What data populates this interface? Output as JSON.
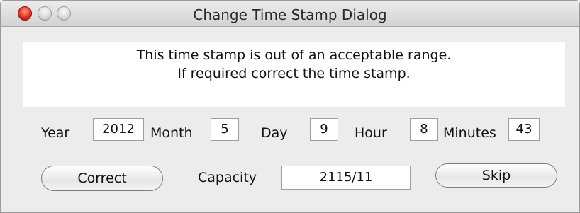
{
  "window": {
    "title": "Change Time Stamp Dialog"
  },
  "message": {
    "line1": "This time stamp is out of an acceptable range.",
    "line2": "If required correct the time stamp."
  },
  "fields": {
    "year_label": "Year",
    "year_value": "2012",
    "month_label": "Month",
    "month_value": "5",
    "day_label": "Day",
    "day_value": "9",
    "hour_label": "Hour",
    "hour_value": "8",
    "minutes_label": "Minutes",
    "minutes_value": "43"
  },
  "actions": {
    "correct_label": "Correct",
    "capacity_label": "Capacity",
    "capacity_value": "2115/11",
    "skip_label": "Skip"
  }
}
